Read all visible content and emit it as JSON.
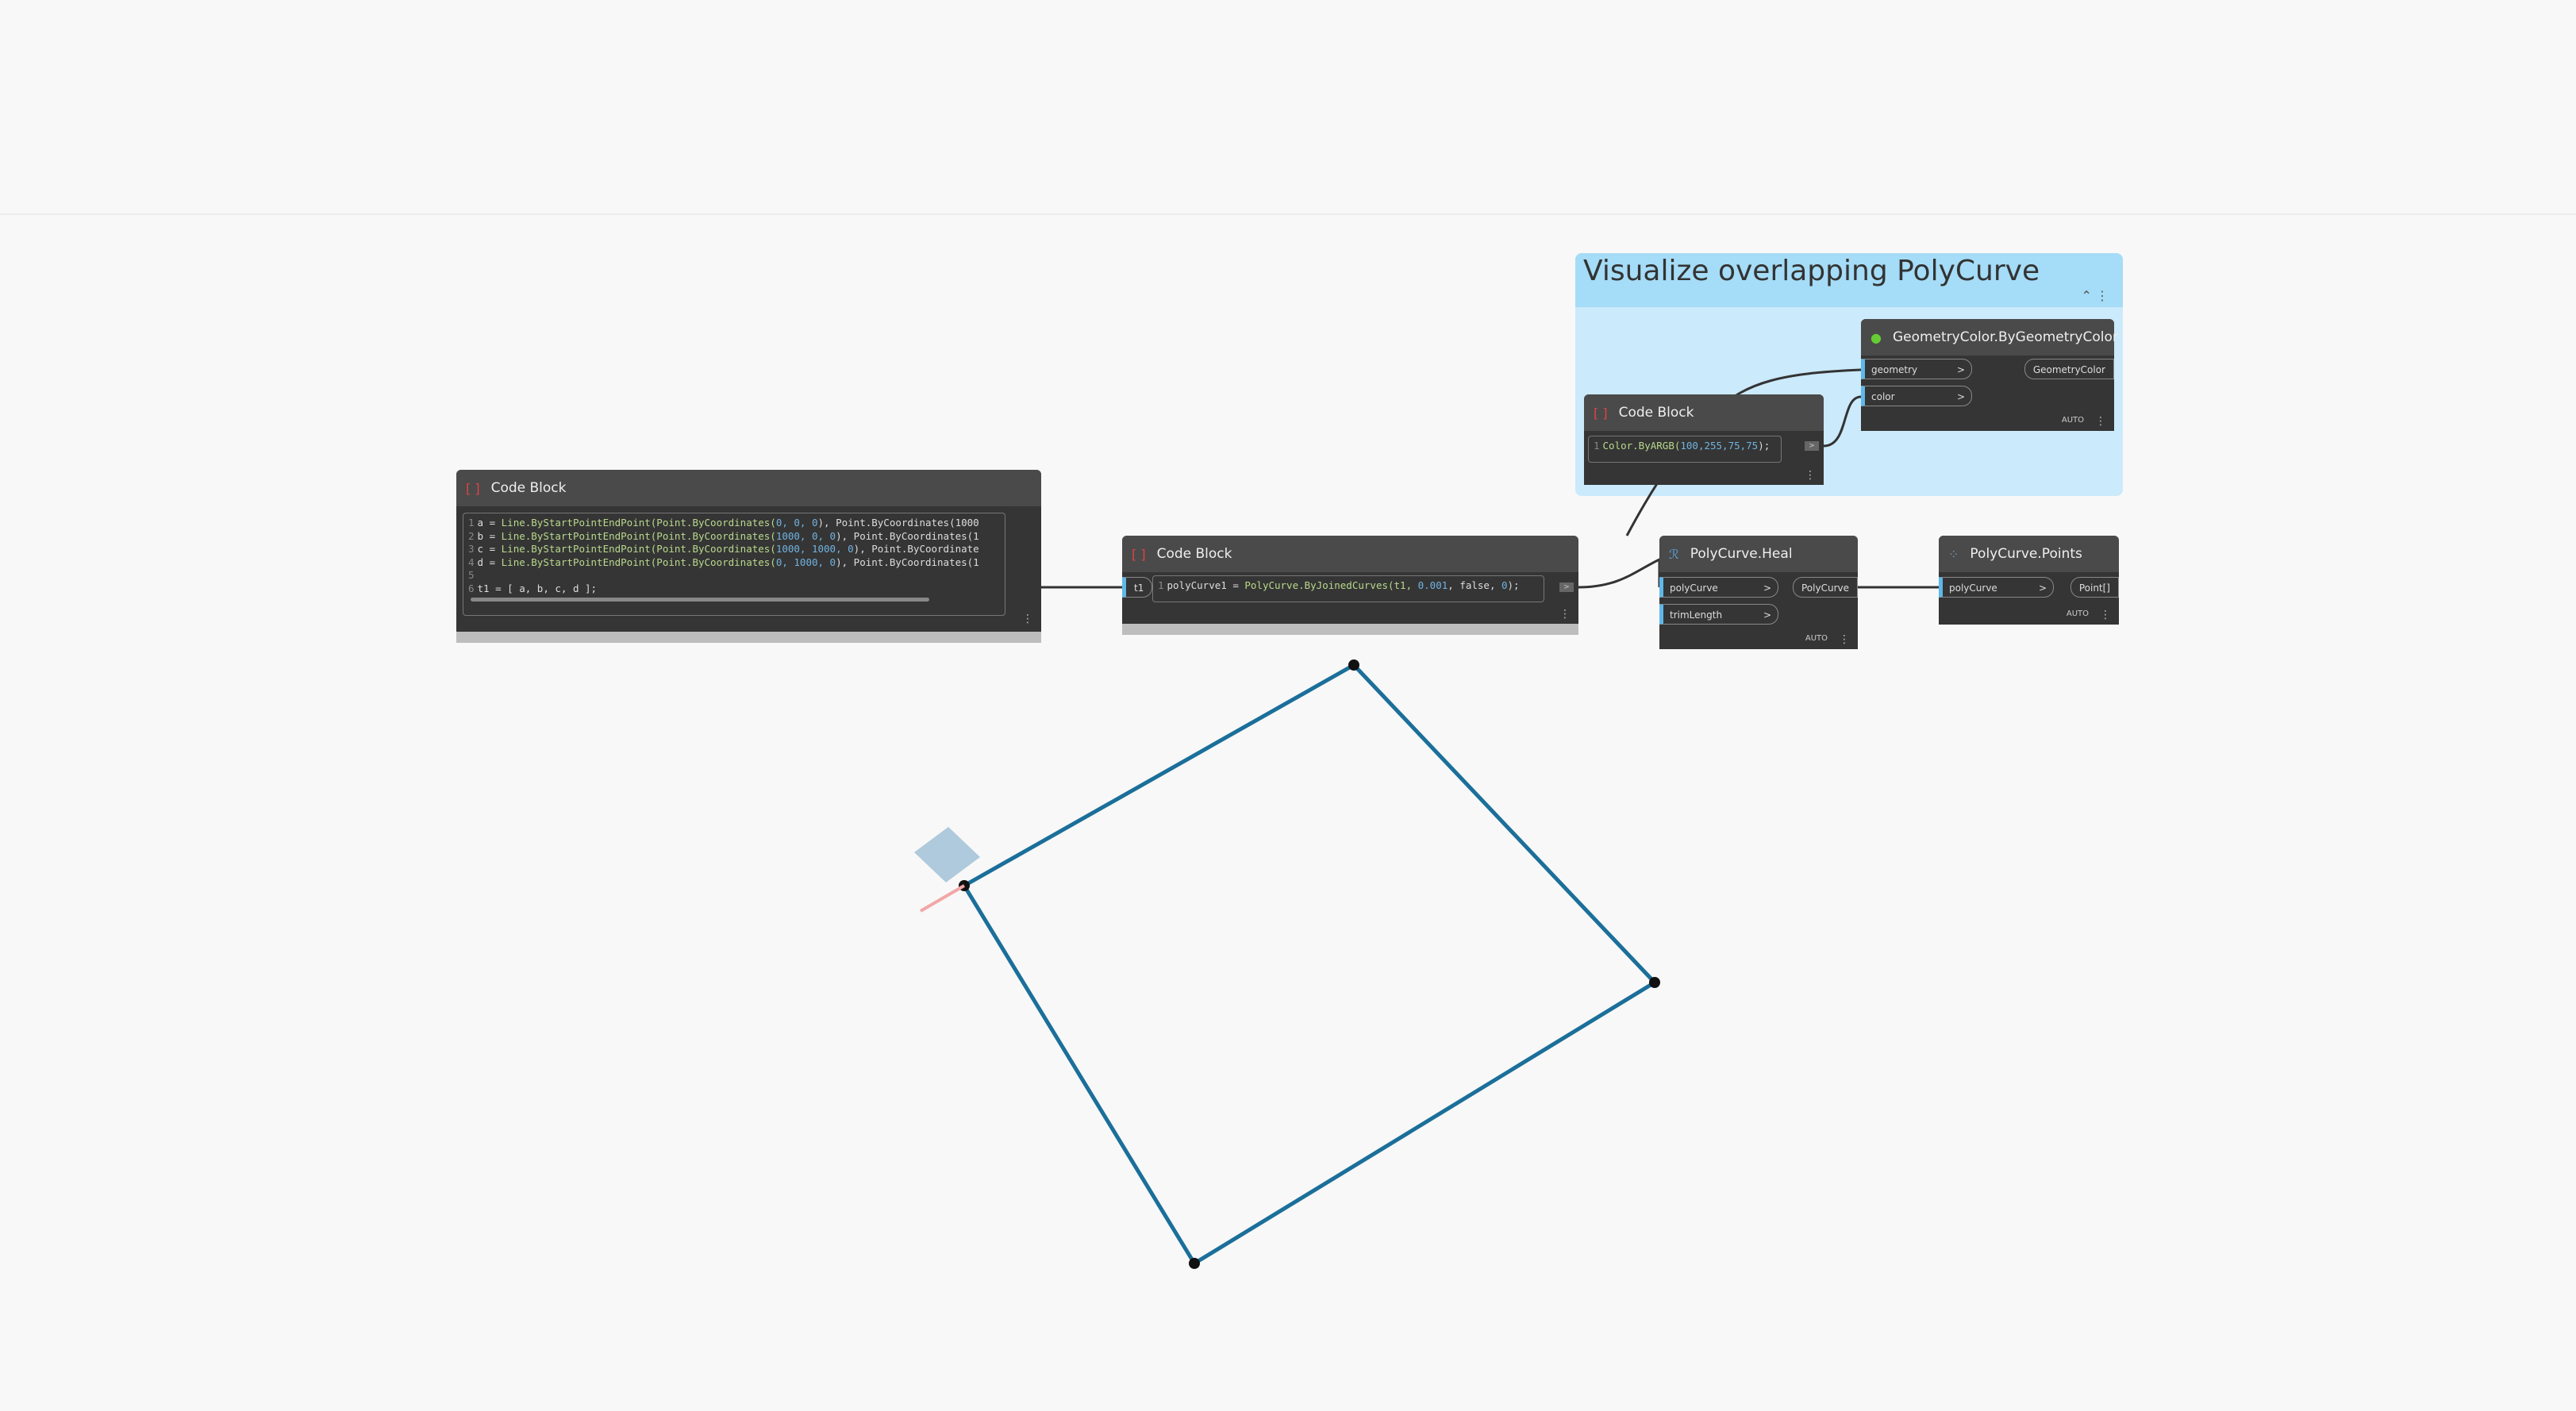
{
  "group": {
    "title": "Visualize overlapping PolyCurve",
    "collapse_icon": "chevron-up-icon"
  },
  "code_block_1": {
    "title": "Code Block",
    "lines": [
      {
        "n": "1",
        "var": "a = ",
        "fn": "Line.ByStartPointEndPoint(Point.ByCoordinates(",
        "args": "0, 0, 0",
        "rest": "), Point.ByCoordinates(1000"
      },
      {
        "n": "2",
        "var": "b = ",
        "fn": "Line.ByStartPointEndPoint(Point.ByCoordinates(",
        "args": "1000, 0, 0",
        "rest": "), Point.ByCoordinates(1"
      },
      {
        "n": "3",
        "var": "c = ",
        "fn": "Line.ByStartPointEndPoint(Point.ByCoordinates(",
        "args": "1000, 1000, 0",
        "rest": "), Point.ByCoordinate"
      },
      {
        "n": "4",
        "var": "d = ",
        "fn": "Line.ByStartPointEndPoint(Point.ByCoordinates(",
        "args": "0, 1000, 0",
        "rest": "), Point.ByCoordinates(1"
      },
      {
        "n": "5",
        "var": "",
        "fn": "",
        "args": "",
        "rest": ""
      },
      {
        "n": "6",
        "var": "t1 = [ a, b, c, d ];",
        "fn": "",
        "args": "",
        "rest": ""
      }
    ]
  },
  "code_block_2": {
    "title": "Code Block",
    "input": "t1",
    "line_no": "1",
    "code_a": "polyCurve1 = ",
    "code_fn": "PolyCurve.ByJoinedCurves(t1, ",
    "code_num": "0.001",
    "code_b": ", false, ",
    "code_num2": "0",
    "code_c": ");"
  },
  "code_block_3": {
    "title": "Code Block",
    "line_no": "1",
    "code_fn": "Color.ByARGB(",
    "code_num": "100,255,75,75",
    "code_c": ");"
  },
  "geometry_color": {
    "title": "GeometryColor.ByGeometryColor",
    "inputs": [
      "geometry",
      "color"
    ],
    "output": "GeometryColor",
    "lacing": "AUTO"
  },
  "heal": {
    "title": "PolyCurve.Heal",
    "inputs": [
      "polyCurve",
      "trimLength"
    ],
    "output": "PolyCurve",
    "lacing": "AUTO"
  },
  "points": {
    "title": "PolyCurve.Points",
    "inputs": [
      "polyCurve"
    ],
    "output": "Point[]",
    "lacing": "AUTO"
  },
  "out_arrow": ">",
  "colors": {
    "curve": "#1b6f9a",
    "group_header": "#a5dcf7",
    "group_body": "#cbeafb",
    "node": "#353535"
  }
}
